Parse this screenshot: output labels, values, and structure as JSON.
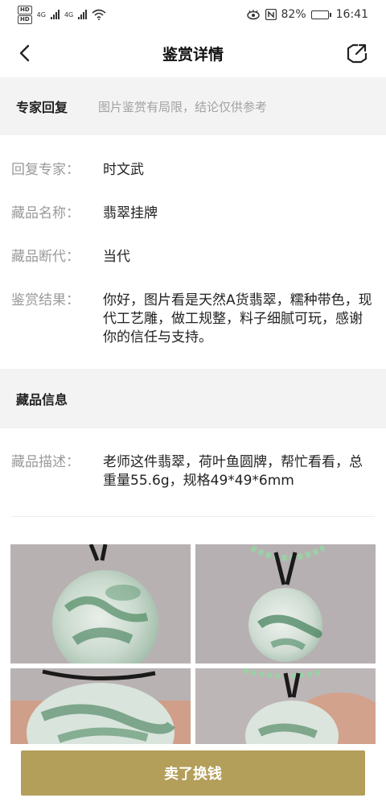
{
  "status_bar": {
    "hd1": "HD",
    "hd2": "HD",
    "net1": "4G",
    "net2": "4G",
    "battery": "82%",
    "time": "16:41",
    "battery_level": 0.82
  },
  "nav": {
    "title": "鉴赏详情"
  },
  "expert_section": {
    "title": "专家回复",
    "note": "图片鉴赏有局限，结论仅供参考"
  },
  "expert_rows": [
    {
      "label": "回复专家：",
      "value": "时文武"
    },
    {
      "label": "藏品名称：",
      "value": "翡翠挂牌"
    },
    {
      "label": "藏品断代：",
      "value": "当代"
    },
    {
      "label": "鉴赏结果：",
      "value": "你好，图片看是天然A货翡翠，糯种带色，现代工艺雕，做工规整，料子细腻可玩，感谢你的信任与支持。"
    }
  ],
  "collection_section": {
    "title": "藏品信息"
  },
  "description": {
    "label": "藏品描述：",
    "value": "老师这件翡翠，荷叶鱼圆牌，帮忙看看，总重量55.6g，规格49*49*6mm"
  },
  "button": {
    "sell_label": "卖了换钱"
  }
}
